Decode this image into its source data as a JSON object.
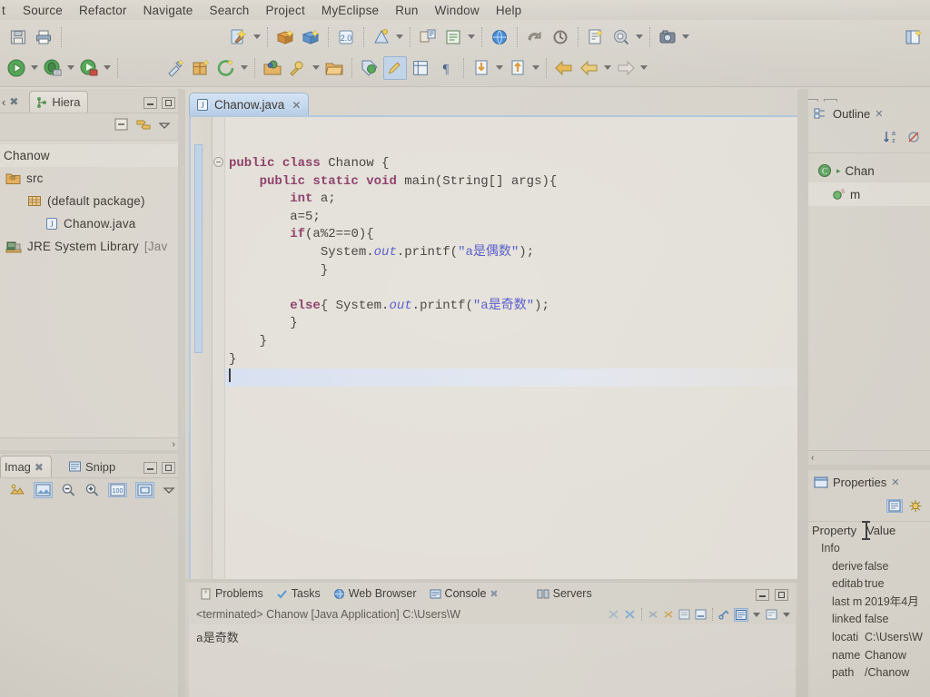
{
  "menubar": {
    "items": [
      {
        "label": "t",
        "clipped": true
      },
      {
        "label": "Source"
      },
      {
        "label": "Refactor"
      },
      {
        "label": "Navigate"
      },
      {
        "label": "Search"
      },
      {
        "label": "Project"
      },
      {
        "label": "MyEclipse"
      },
      {
        "label": "Run"
      },
      {
        "label": "Window"
      },
      {
        "label": "Help"
      }
    ]
  },
  "toolbar": {
    "row1": [
      {
        "name": "save-icon"
      },
      {
        "name": "print-icon"
      },
      {
        "name": "new-wizard-icon"
      },
      {
        "name": "new-wizard-dropdown"
      },
      {
        "name": "open-perspective-icon"
      },
      {
        "name": "deploy-icon"
      },
      {
        "name": "database-explorer-icon"
      },
      {
        "name": "flask-icon"
      },
      {
        "name": "profile-icon"
      },
      {
        "name": "profile-dropdown"
      },
      {
        "name": "report-icon"
      },
      {
        "name": "list-icon"
      },
      {
        "name": "list-dropdown"
      },
      {
        "name": "browser-globe-icon"
      },
      {
        "name": "undo-history-icon"
      },
      {
        "name": "redo-history-icon"
      },
      {
        "name": "new-file-icon"
      },
      {
        "name": "search-globe-icon"
      },
      {
        "name": "search-dropdown"
      },
      {
        "name": "camera-icon"
      },
      {
        "name": "camera-dropdown"
      },
      {
        "name": "perspective-open-icon"
      }
    ],
    "row2": [
      {
        "name": "run-icon"
      },
      {
        "name": "run-dropdown"
      },
      {
        "name": "debug-icon"
      },
      {
        "name": "debug-dropdown"
      },
      {
        "name": "run-external-icon"
      },
      {
        "name": "external-dropdown"
      },
      {
        "name": "build-icon"
      },
      {
        "name": "package-icon"
      },
      {
        "name": "refresh-icon"
      },
      {
        "name": "refresh-dropdown"
      },
      {
        "name": "open-type-icon"
      },
      {
        "name": "open-resource-icon"
      },
      {
        "name": "open-resource-dropdown"
      },
      {
        "name": "folder-open-icon"
      },
      {
        "name": "tag-icon"
      },
      {
        "name": "edit-pencil-icon",
        "selected": true
      },
      {
        "name": "table-icon"
      },
      {
        "name": "paragraph-marks-icon"
      },
      {
        "name": "download-icon"
      },
      {
        "name": "download-dropdown"
      },
      {
        "name": "upload-icon"
      },
      {
        "name": "upload-dropdown"
      },
      {
        "name": "back-arrow-icon"
      },
      {
        "name": "forward-arrow-icon"
      },
      {
        "name": "forward-dropdown"
      },
      {
        "name": "next-arrow-icon"
      },
      {
        "name": "next-dropdown"
      }
    ]
  },
  "left_panel": {
    "tabs": [
      {
        "label": "",
        "name": "tab-package-explorer",
        "active": false
      },
      {
        "label": "Hiera",
        "name": "tab-hierarchy",
        "active": true
      }
    ],
    "view_buttons": [
      "minimize",
      "maximize"
    ],
    "toolbar_icons": [
      "collapse-all-icon",
      "link-with-editor-icon",
      "view-menu-icon"
    ],
    "tree": [
      {
        "label": "Chanow",
        "indent": 0,
        "icon": "project-icon",
        "selected": true
      },
      {
        "label": "src",
        "indent": 1,
        "icon": "source-folder-icon"
      },
      {
        "label": "(default package)",
        "indent": 2,
        "icon": "package-icon"
      },
      {
        "label": "Chanow.java",
        "indent": 3,
        "icon": "java-file-icon"
      },
      {
        "label": "JRE System Library",
        "suffix": "[Jav",
        "indent": 1,
        "icon": "jre-library-icon"
      }
    ]
  },
  "bottom_left_panel": {
    "tabs": [
      {
        "label": "Imag",
        "name": "tab-image",
        "active": true
      },
      {
        "label": "Snipp",
        "name": "tab-snippets",
        "active": false
      }
    ],
    "toolbar_icons": [
      "image-icon",
      "select-image-icon",
      "zoom-out-icon",
      "zoom-in-icon",
      "actual-size-icon",
      "fit-window-icon",
      "view-menu-icon"
    ]
  },
  "editor": {
    "tab": {
      "label": "Chanow.java",
      "icon": "java-file-icon",
      "close": "✕"
    },
    "window_buttons": [
      "minimize",
      "maximize"
    ],
    "scroll_up": "⌃",
    "scroll_down": "⌄",
    "lines": [
      {
        "id": 1,
        "indent": 0,
        "segments": [
          {
            "t": "public ",
            "c": "kw"
          },
          {
            "t": "class ",
            "c": "kw"
          },
          {
            "t": "Chanow {",
            "c": ""
          }
        ]
      },
      {
        "id": 2,
        "indent": 1,
        "segments": [
          {
            "t": "public ",
            "c": "kw"
          },
          {
            "t": "static ",
            "c": "kw"
          },
          {
            "t": "void ",
            "c": "kw"
          },
          {
            "t": "main(String[] args){",
            "c": ""
          }
        ]
      },
      {
        "id": 3,
        "indent": 2,
        "segments": [
          {
            "t": "int ",
            "c": "kw"
          },
          {
            "t": "a;",
            "c": ""
          }
        ]
      },
      {
        "id": 4,
        "indent": 2,
        "segments": [
          {
            "t": "a=5;",
            "c": ""
          }
        ]
      },
      {
        "id": 5,
        "indent": 2,
        "segments": [
          {
            "t": "if",
            "c": "kw"
          },
          {
            "t": "(a%2==0){",
            "c": ""
          }
        ]
      },
      {
        "id": 6,
        "indent": 3,
        "segments": [
          {
            "t": "System.",
            "c": ""
          },
          {
            "t": "out",
            "c": "fld"
          },
          {
            "t": ".printf(",
            "c": ""
          },
          {
            "t": "\"a是偶数\"",
            "c": "str"
          },
          {
            "t": ");",
            "c": ""
          }
        ]
      },
      {
        "id": 7,
        "indent": 3,
        "segments": [
          {
            "t": "}",
            "c": ""
          }
        ]
      },
      {
        "id": 8,
        "indent": 0,
        "segments": [
          {
            "t": "",
            "c": ""
          }
        ]
      },
      {
        "id": 9,
        "indent": 2,
        "segments": [
          {
            "t": "else",
            "c": "kw"
          },
          {
            "t": "{ System.",
            "c": ""
          },
          {
            "t": "out",
            "c": "fld"
          },
          {
            "t": ".printf(",
            "c": ""
          },
          {
            "t": "\"a是奇数\"",
            "c": "str"
          },
          {
            "t": ");",
            "c": ""
          }
        ]
      },
      {
        "id": 10,
        "indent": 2,
        "segments": [
          {
            "t": "}",
            "c": ""
          }
        ]
      },
      {
        "id": 11,
        "indent": 1,
        "segments": [
          {
            "t": "}",
            "c": ""
          }
        ]
      },
      {
        "id": 12,
        "indent": 0,
        "segments": [
          {
            "t": "}",
            "c": ""
          }
        ]
      },
      {
        "id": 13,
        "indent": 0,
        "segments": [
          {
            "t": "",
            "c": ""
          }
        ],
        "caret": true,
        "highlight": true
      }
    ]
  },
  "console": {
    "tabs": [
      {
        "label": "Problems",
        "name": "tab-problems",
        "icon": "problems-icon"
      },
      {
        "label": "Tasks",
        "name": "tab-tasks",
        "icon": "tasks-icon"
      },
      {
        "label": "Web Browser",
        "name": "tab-web-browser",
        "icon": "browser-icon"
      },
      {
        "label": "Console",
        "name": "tab-console",
        "icon": "console-icon",
        "active": true
      },
      {
        "label": "Servers",
        "name": "tab-servers",
        "icon": "servers-icon"
      }
    ],
    "window_buttons": [
      "minimize",
      "maximize"
    ],
    "header": "<terminated> Chanow [Java Application] C:\\Users\\W",
    "toolbar_icons": [
      "terminate-icon",
      "terminate-all-icon",
      "remove-launch-icon",
      "remove-all-icon",
      "clear-console-icon",
      "scroll-lock-icon",
      "pin-console-icon",
      "display-selected-console-icon",
      "display-dropdown",
      "open-console-icon",
      "open-console-dropdown"
    ],
    "output": "a是奇数"
  },
  "outline": {
    "tab": {
      "label": "Outline",
      "icon": "outline-icon",
      "close": "✕"
    },
    "toolbar_icons": [
      "sort-az-icon",
      "hide-fields-icon"
    ],
    "tree": [
      {
        "label": "Chan",
        "icon": "class-icon"
      },
      {
        "label": "m",
        "icon": "method-icon",
        "badge": "S"
      }
    ],
    "scroll_left": "‹"
  },
  "properties": {
    "tab": {
      "label": "Properties",
      "icon": "properties-icon",
      "close": "✕"
    },
    "toolbar_icons": [
      "restore-defaults-icon",
      "advanced-icon"
    ],
    "columns": [
      "Property",
      "Value"
    ],
    "rows": [
      {
        "level": 1,
        "property": "Info",
        "value": ""
      },
      {
        "level": 2,
        "property": "derive",
        "value": "false"
      },
      {
        "level": 2,
        "property": "editab",
        "value": "true"
      },
      {
        "level": 2,
        "property": "last m",
        "value": "2019年4月"
      },
      {
        "level": 2,
        "property": "linked",
        "value": "false"
      },
      {
        "level": 2,
        "property": "locati",
        "value": "C:\\Users\\W"
      },
      {
        "level": 2,
        "property": "name",
        "value": "Chanow"
      },
      {
        "level": 2,
        "property": "path",
        "value": "/Chanow"
      }
    ]
  },
  "colors": {
    "keyword": "#7b2050",
    "string": "#3a3ec0",
    "field": "#3a3ec0",
    "tab_active": "#b9cde4",
    "chrome": "#d2cec5"
  }
}
